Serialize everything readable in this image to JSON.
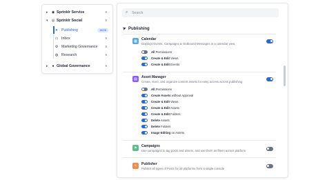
{
  "nav": {
    "groups": [
      {
        "label": "Sprinklr Service",
        "count": "8",
        "icon": "service-icon",
        "expanded": false
      },
      {
        "label": "Sprinklr Social",
        "count": "8",
        "icon": "social-icon",
        "expanded": true
      },
      {
        "label": "Global Governance",
        "count": "8",
        "icon": "globe-icon",
        "expanded": false
      }
    ],
    "social_items": [
      {
        "label": "Publishing",
        "count": "18/28",
        "active": true,
        "icon": "send-icon"
      },
      {
        "label": "Inbox",
        "count": "8",
        "active": false,
        "icon": "inbox-icon"
      },
      {
        "label": "Marketing Governance",
        "count": "8",
        "active": false,
        "icon": "governance-icon"
      },
      {
        "label": "Research",
        "count": "8",
        "active": false,
        "icon": "research-icon"
      }
    ]
  },
  "search": {
    "placeholder": "Search"
  },
  "section": {
    "title": "Publishing"
  },
  "apps": {
    "calendar": {
      "title": "Calendar",
      "desc": "Displays Events, Campaigns & Outbound Messages in a calendar view",
      "enabled": true,
      "color": "#5aa7e8",
      "permissions": [
        {
          "bold": "All",
          "rest": " Permissions",
          "on": false
        },
        {
          "bold": "Create & Edit",
          "rest": " Views",
          "on": true
        },
        {
          "bold": "Create & Edit",
          "rest": " Events",
          "on": true
        }
      ]
    },
    "asset_manager": {
      "title": "Asset Manager",
      "desc": "Create, store, and organize content assets for easy access across publishing",
      "enabled": true,
      "color": "#8b5cf6",
      "permissions": [
        {
          "bold": "All",
          "rest": " Permissions",
          "on": false
        },
        {
          "bold": "Create Assets",
          "rest": " without Approval",
          "on": true
        },
        {
          "bold": "Create & Edit",
          "rest": " Views",
          "on": true
        },
        {
          "bold": "Create & Edit",
          "rest": " Assets",
          "on": true
        },
        {
          "bold": "Create & Edit",
          "rest": " Folders",
          "on": true
        },
        {
          "bold": "Delete",
          "rest": " Assets",
          "on": true
        },
        {
          "bold": "Delete",
          "rest": " Folders",
          "on": true
        },
        {
          "bold": "Image Editing",
          "rest": " on Assets",
          "on": true
        }
      ]
    },
    "campaigns": {
      "title": "Campaigns",
      "desc": "Use campaigns to tag posts and assets, and use them as filters across platform",
      "enabled": false,
      "color": "#5bbf8a"
    },
    "publisher": {
      "title": "Publisher",
      "desc": "Publish all types of Posts for all platforms from a single console",
      "enabled": false,
      "color": "#f08a4b"
    }
  }
}
